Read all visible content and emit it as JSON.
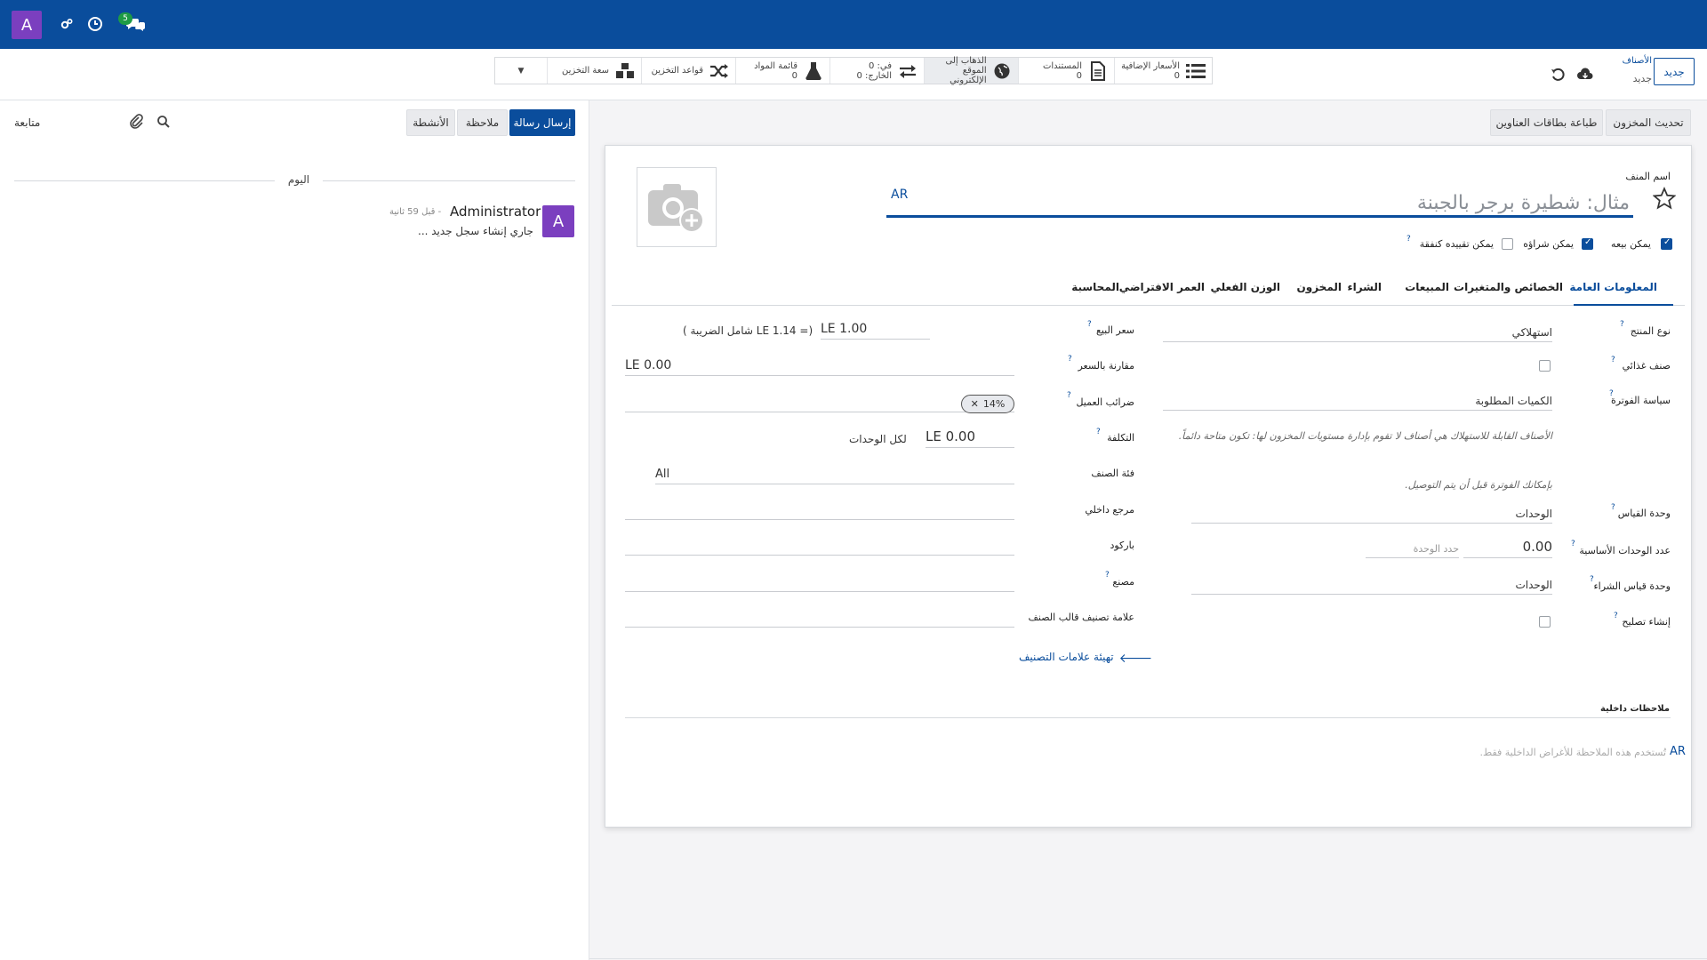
{
  "navbar": {
    "user_initial": "A",
    "messages_badge": "5"
  },
  "breadcrumb": {
    "parent": "الأصناف",
    "current": "جديد",
    "new_button": "جديد"
  },
  "smart_buttons": {
    "extra_prices": {
      "label": "الأسعار الإضافية",
      "count": "0"
    },
    "documents": {
      "label": "المستندات",
      "count": "0"
    },
    "website": {
      "line1": "الذهاب إلى",
      "line2": "الموقع الإلكتروني"
    },
    "in_out": {
      "in": "في: 0",
      "out": "الخارج: 0"
    },
    "bom": {
      "label": "قائمة المواد",
      "count": "0"
    },
    "routes": {
      "label": "قواعد التخزين"
    },
    "putaway": {
      "label": "سعة التخزين"
    }
  },
  "form_actions": {
    "update_qty": "تحديث المخزون",
    "print_labels": "طباعة بطاقات العناوين"
  },
  "chatter": {
    "send_message": "إرسال رسالة",
    "log_note": "ملاحظة",
    "activities": "الأنشطة",
    "follow": "متابعة",
    "today": "اليوم",
    "author": "Administrator",
    "time": "- قبل 59 ثانية",
    "body": "جاري إنشاء سجل جديد ..."
  },
  "product": {
    "name_label": "اسم المنف",
    "name_placeholder": "مثال: شطيرة برجر بالجبنة",
    "lang": "AR",
    "can_be_sold": "يمكن بيعه",
    "can_be_purchased": "يمكن شراؤه",
    "can_be_expensed": "يمكن تقييده كنفقة"
  },
  "tabs": [
    "المعلومات العامة",
    "الخصائص والمتغيرات",
    "المبيعات",
    "الشراء",
    "المخزون",
    "الوزن الفعلي",
    "العمر الافتراضي",
    "المحاسبة"
  ],
  "general": {
    "product_type_label": "نوع المنتج",
    "product_type": "استهلاكي",
    "food_label": "صنف غذائي",
    "invoicing_label": "سياسة الفوترة",
    "invoicing": "الكميات المطلوبة",
    "hint1": "الأصناف القابلة للاستهلاك هي أصناف لا تقوم بإدارة مستويات المخزون لها: تكون متاحة دائماً.",
    "hint2": "بإمكانك الفوترة قبل أن يتم التوصيل.",
    "uom_label": "وحدة القياس",
    "uom": "الوحدات",
    "base_units_label": "عدد الوحدات الأساسية",
    "base_units": "0.00",
    "unit_placeholder": "حدد الوحدة",
    "purchase_uom_label": "وحدة قياس الشراء",
    "purchase_uom": "الوحدات",
    "create_repair_label": "إنشاء تصليح",
    "sales_price_label": "سعر البيع",
    "sales_price": "LE 1.00",
    "price_incl": "(= LE 1.14 شامل الضريبة )",
    "compare_label": "مقارنة بالسعر",
    "compare": "LE 0.00",
    "taxes_label": "ضرائب العميل",
    "tax_tag": "14%",
    "cost_label": "التكلفة",
    "cost": "LE 0.00",
    "cost_per": "لكل الوحدات",
    "category_label": "فئة الصنف",
    "category": "All",
    "internal_ref_label": "مرجع داخلي",
    "barcode_label": "باركود",
    "manufacturer_label": "مصنع",
    "tags_label": "علامة تصنيف قالب الصنف",
    "configure_tags": "تهيئة علامات التصنيف",
    "internal_notes_label": "ملاحظات داخلية",
    "notes_placeholder": "تُستخدم هذه الملاحظة للأغراض الداخلية فقط.",
    "notes_lang": "AR"
  },
  "colors": {
    "brand": "#0a4d9c",
    "avatar": "#7b3fbf"
  }
}
